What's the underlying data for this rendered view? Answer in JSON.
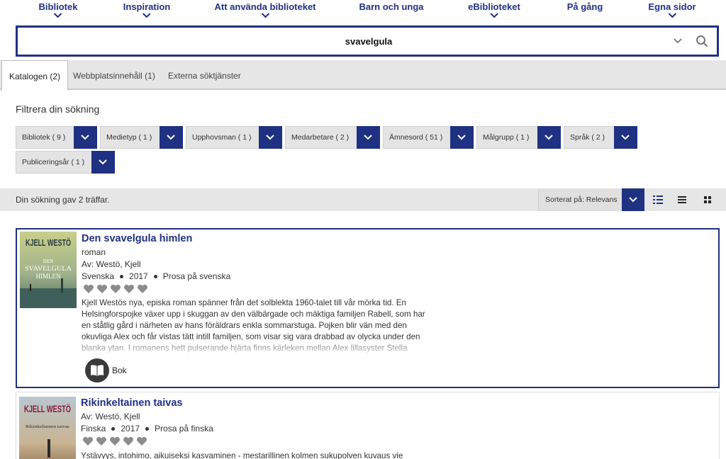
{
  "nav": {
    "items": [
      {
        "label": "Bibliotek",
        "has_dropdown": true
      },
      {
        "label": "Inspiration",
        "has_dropdown": true
      },
      {
        "label": "Att använda biblioteket",
        "has_dropdown": true
      },
      {
        "label": "Barn och unga",
        "has_dropdown": false
      },
      {
        "label": "eBiblioteket",
        "has_dropdown": true
      },
      {
        "label": "På gång",
        "has_dropdown": false
      },
      {
        "label": "Egna sidor",
        "has_dropdown": true
      }
    ]
  },
  "search": {
    "value": "svavelgula",
    "icon": "search-icon"
  },
  "tabs": [
    {
      "label": "Katalogen (2)",
      "active": true
    },
    {
      "label": "Webbplatsinnehåll (1)",
      "active": false
    },
    {
      "label": "Externa söktjänster",
      "active": false
    }
  ],
  "filters": {
    "title": "Filtrera din sökning",
    "items": [
      {
        "label": "Bibliotek  ( 9 )"
      },
      {
        "label": "Medietyp  ( 1 )"
      },
      {
        "label": "Upphovsman  ( 1 )"
      },
      {
        "label": "Medarbetare  ( 2 )"
      },
      {
        "label": "Ämnesord  ( 51 )"
      },
      {
        "label": "Målgrupp  ( 1 )"
      },
      {
        "label": "Språk  ( 2 )"
      },
      {
        "label": "Publiceringsår  ( 1 )"
      }
    ]
  },
  "results_bar": {
    "count_text": "Din sökning gav 2 träffar.",
    "sort_label": "Sorterat på: Relevans",
    "views": [
      "detail-list-icon",
      "list-icon",
      "grid-icon"
    ]
  },
  "results": [
    {
      "title": "Den svavelgula himlen",
      "subtitle": "roman",
      "author": "Av: Westö, Kjell",
      "language": "Svenska",
      "year": "2017",
      "category": "Prosa på svenska",
      "rating": 0,
      "description": "Kjell Westös nya, episka roman spänner från det solblekta 1960-talet till vår mörka tid. En Helsingforspojke växer upp i skuggan av den välbärgade och mäktiga familjen Rabell, som har en ståtlig gård i närheten av hans föräldrars enkla sommarstuga. Pojken blir vän med den okuvliga Alex och får vistas tätt intill familjen, som visar sig vara drabbad av olycka under den blanka ytan. I romanens hett pulserande hjärta finns kärleken mellan Alex lillasyster Stella",
      "format": "Bok",
      "cover": {
        "author": "KJELL WESTÖ",
        "title_lines": [
          "DEN",
          "SVAVELGULA",
          "HIMLEN"
        ]
      }
    },
    {
      "title": "Rikinkeltainen taivas",
      "author": "Av: Westö, Kjell",
      "language": "Finska",
      "year": "2017",
      "category": "Prosa på finska",
      "rating": 0,
      "description": "Ystävyys, intohimo, aikuiseksi kasvaminen - mestarillinen kolmen sukupolven kuvaus vie",
      "cover": {
        "author": "KJELL WESTÖ",
        "title_lines": [
          "Rikinkeltainen taivas"
        ]
      }
    }
  ],
  "colors": {
    "brand": "#1f3182",
    "tab_bg": "#e6e6e6",
    "heart": "#8c8c8c"
  }
}
